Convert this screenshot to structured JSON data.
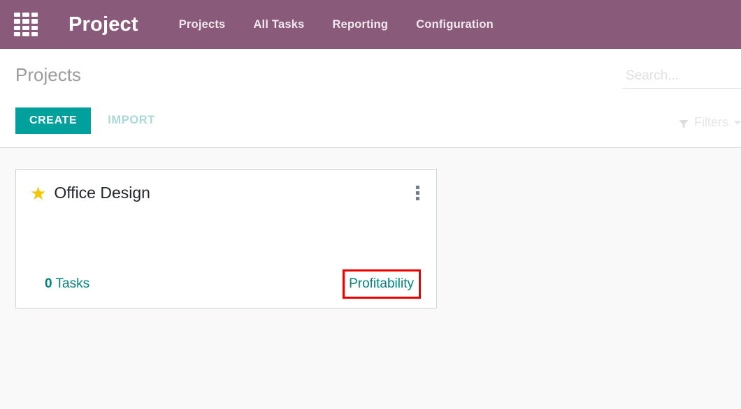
{
  "navbar": {
    "apps_icon": "apps-grid-icon",
    "brand": "Project",
    "menu": [
      {
        "label": "Projects"
      },
      {
        "label": "All Tasks"
      },
      {
        "label": "Reporting"
      },
      {
        "label": "Configuration"
      }
    ],
    "background_color": "#8a5a7a"
  },
  "control_panel": {
    "breadcrumb": "Projects",
    "create_label": "CREATE",
    "import_label": "IMPORT",
    "create_color": "#00a09d",
    "search": {
      "value": "",
      "placeholder": "Search..."
    },
    "filters_label": "Filters",
    "filters_icon": "funnel-icon"
  },
  "kanban": {
    "cards": [
      {
        "favorite_icon": "star-icon",
        "favorite": true,
        "title": "Office Design",
        "menu_icon": "kebab-menu-icon",
        "tasks_count": "0",
        "tasks_label": "Tasks",
        "profitability_label": "Profitability",
        "link_color": "#00827f",
        "annotated": true,
        "annotation_color": "#ee0000"
      }
    ]
  }
}
